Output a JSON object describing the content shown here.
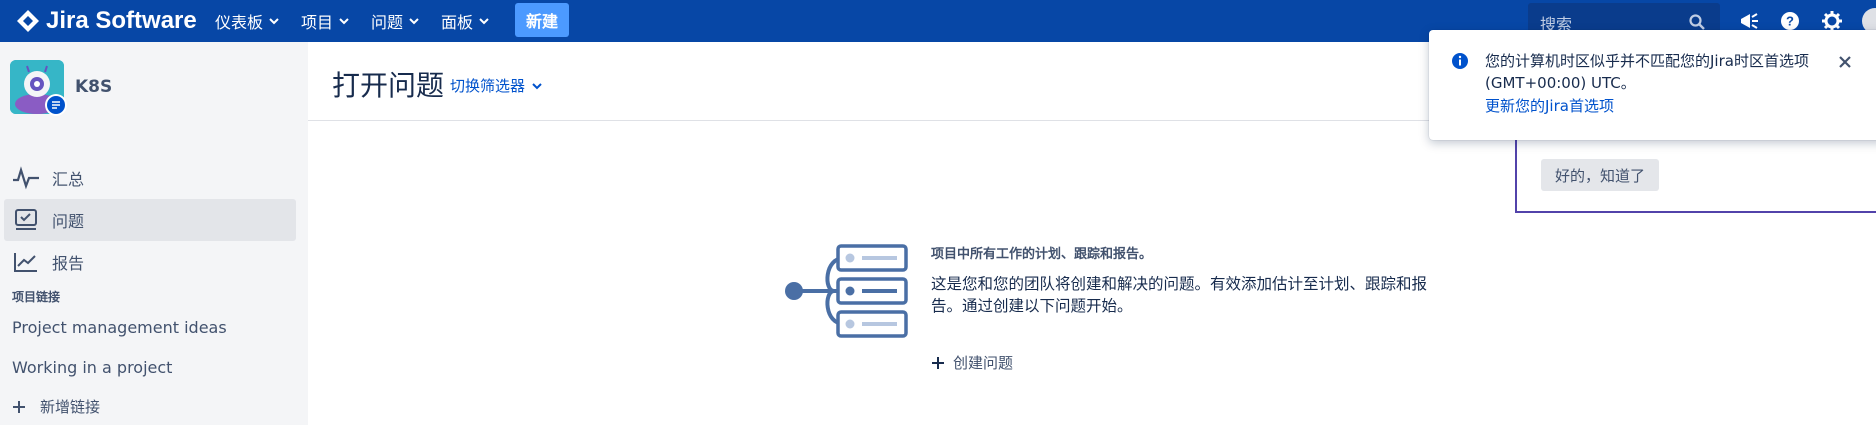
{
  "topbar": {
    "logo_text": "Jira Software",
    "nav": [
      {
        "label": "仪表板"
      },
      {
        "label": "项目"
      },
      {
        "label": "问题"
      },
      {
        "label": "面板"
      }
    ],
    "create_label": "新建",
    "search_placeholder": "搜索",
    "colors": {
      "background": "#0747a6",
      "create_button": "#4c9aff"
    }
  },
  "sidebar": {
    "project_name": "K8S",
    "items": [
      {
        "label": "汇总",
        "icon": "activity-icon"
      },
      {
        "label": "问题",
        "icon": "issues-icon"
      },
      {
        "label": "报告",
        "icon": "chart-icon"
      }
    ],
    "section_title": "项目链接",
    "links": [
      {
        "label": "Project management ideas"
      },
      {
        "label": "Working in a project"
      }
    ],
    "add_link_label": "新增链接"
  },
  "main": {
    "title": "打开问题",
    "switch_filter_label": "切换筛选器",
    "empty_heading": "项目中所有工作的计划、跟踪和报告。",
    "empty_body": "这是您和您的团队将创建和解决的问题。有效添加估计至计划、跟踪和报告。通过创建以下问题开始。",
    "create_issue_label": "创建问题"
  },
  "onboarding": {
    "button_label": "好的，知道了"
  },
  "flag": {
    "message": "您的计算机时区似乎并不匹配您的Jira时区首选项(GMT+00:00) UTC。",
    "link_label": "更新您的Jira首选项"
  }
}
